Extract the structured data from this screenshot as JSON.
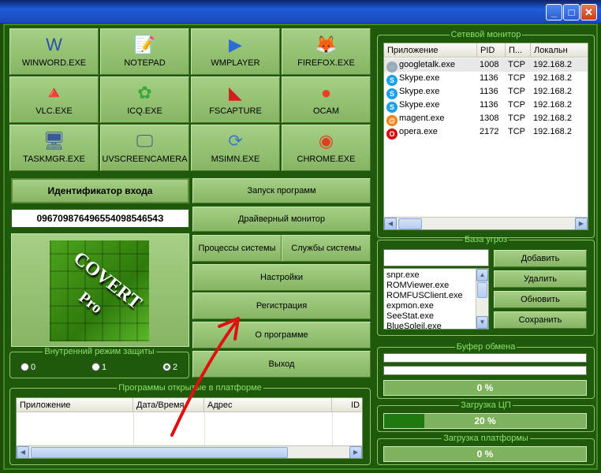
{
  "apps": [
    {
      "label": "WINWORD.EXE",
      "icon": "W"
    },
    {
      "label": "NOTEPAD",
      "icon": "📝"
    },
    {
      "label": "WMPLAYER",
      "icon": "▶"
    },
    {
      "label": "FIREFOX.EXE",
      "icon": "🦊"
    },
    {
      "label": "VLC.EXE",
      "icon": "🔺"
    },
    {
      "label": "ICQ.EXE",
      "icon": "✿"
    },
    {
      "label": "FSCAPTURE",
      "icon": "◣"
    },
    {
      "label": "OCAM",
      "icon": "●"
    },
    {
      "label": "TASKMGR.EXE",
      "icon": "🖥"
    },
    {
      "label": "UVSCREENCAMERA",
      "icon": "🖵"
    },
    {
      "label": "MSIMN.EXE",
      "icon": "⟳"
    },
    {
      "label": "CHROME.EXE",
      "icon": "◉"
    }
  ],
  "login": {
    "title": "Идентификатор входа",
    "value": "09670987649655409854654З"
  },
  "logo": {
    "line1": "COVERT",
    "line2": "Pro"
  },
  "menu": {
    "launch": "Запуск программ",
    "driver_monitor": "Драйверный монитор",
    "processes": "Процессы системы",
    "services": "Службы системы",
    "settings": "Настройки",
    "registration": "Регистрация",
    "about": "О программе",
    "exit": "Выход"
  },
  "protection": {
    "legend": "Внутренний режим защиты",
    "options": [
      "0",
      "1",
      "2"
    ],
    "selected": "2"
  },
  "open_programs": {
    "legend": "Программы открытые в платформе",
    "columns": [
      "Приложение",
      "Дата/Время",
      "Адрес",
      "ID"
    ]
  },
  "network_monitor": {
    "legend": "Сетевой монитор",
    "columns": [
      "Приложение",
      "PID",
      "П...",
      "Локальн"
    ],
    "rows": [
      {
        "app": "googletalk.exe",
        "pid": "1008",
        "proto": "TCP",
        "local": "192.168.2",
        "icon": "talk"
      },
      {
        "app": "Skype.exe",
        "pid": "1136",
        "proto": "TCP",
        "local": "192.168.2",
        "icon": "skype"
      },
      {
        "app": "Skype.exe",
        "pid": "1136",
        "proto": "TCP",
        "local": "192.168.2",
        "icon": "skype"
      },
      {
        "app": "Skype.exe",
        "pid": "1136",
        "proto": "TCP",
        "local": "192.168.2",
        "icon": "skype"
      },
      {
        "app": "magent.exe",
        "pid": "1308",
        "proto": "TCP",
        "local": "192.168.2",
        "icon": "mail"
      },
      {
        "app": "opera.exe",
        "pid": "2172",
        "proto": "TCP",
        "local": "192.168.2",
        "icon": "opera"
      }
    ]
  },
  "threat_db": {
    "legend": "База угроз",
    "input_value": "",
    "items": [
      "snpr.exe",
      "ROMViewer.exe",
      "ROMFUSClient.exe",
      "expmon.exe",
      "SeeStat.exe",
      "BlueSoleil.exe"
    ],
    "buttons": {
      "add": "Добавить",
      "delete": "Удалить",
      "update": "Обновить",
      "save": "Сохранить"
    }
  },
  "clipboard": {
    "legend": "Буфер обмена",
    "percent_text": "0 %",
    "percent": 0
  },
  "cpu": {
    "legend": "Загрузка ЦП",
    "percent_text": "20 %",
    "percent": 20
  },
  "platform": {
    "legend": "Загрузка платформы",
    "percent_text": "0 %",
    "percent": 0
  },
  "colors": {
    "accent_green": "#1e7a10",
    "legend_green": "#8ee06a",
    "arrow_red": "#e01010"
  }
}
